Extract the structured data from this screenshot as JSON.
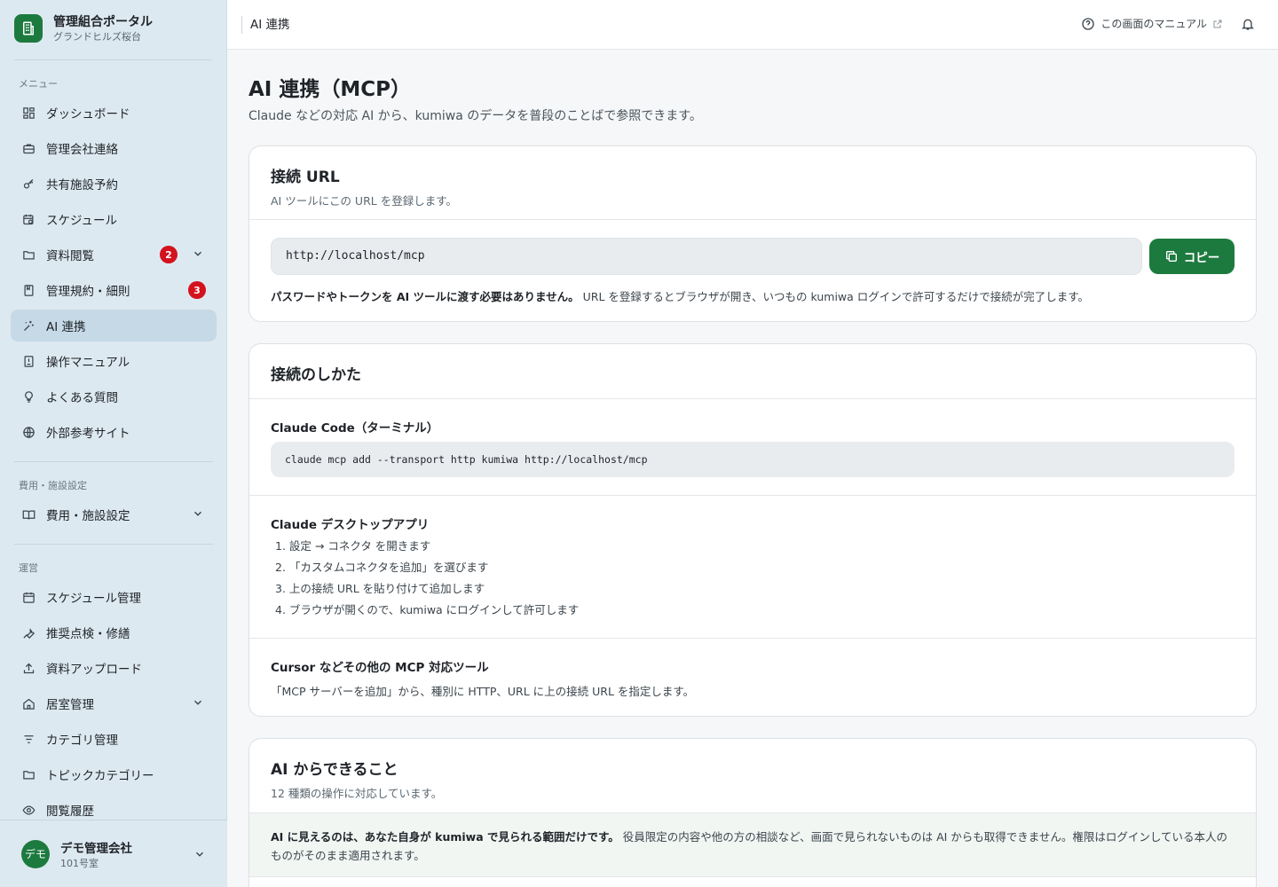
{
  "brand": {
    "title": "管理組合ポータル",
    "subtitle": "グランドヒルズ桜台"
  },
  "sidebar": {
    "menu_label": "メニュー",
    "items": [
      {
        "label": "ダッシュボード",
        "icon": "dashboard-icon"
      },
      {
        "label": "管理会社連絡",
        "icon": "briefcase-icon"
      },
      {
        "label": "共有施設予約",
        "icon": "key-icon"
      },
      {
        "label": "スケジュール",
        "icon": "calendar-clock-icon"
      },
      {
        "label": "資料閲覧",
        "icon": "folder-icon",
        "badge": "2"
      },
      {
        "label": "管理規約・細則",
        "icon": "book-icon",
        "badge": "3"
      },
      {
        "label": "AI 連携",
        "icon": "sparkle-icon",
        "active": true
      },
      {
        "label": "操作マニュアル",
        "icon": "manual-icon"
      },
      {
        "label": "よくある質問",
        "icon": "lightbulb-icon"
      },
      {
        "label": "外部参考サイト",
        "icon": "globe-icon"
      }
    ],
    "fees_label": "費用・施設設定",
    "fees_item": "費用・施設設定",
    "ops_label": "運営",
    "ops_items": [
      {
        "label": "スケジュール管理",
        "icon": "calendar-icon"
      },
      {
        "label": "推奨点検・修繕",
        "icon": "wrench-icon"
      },
      {
        "label": "資料アップロード",
        "icon": "upload-icon"
      },
      {
        "label": "居室管理",
        "icon": "home-icon"
      },
      {
        "label": "カテゴリ管理",
        "icon": "filter-icon"
      },
      {
        "label": "トピックカテゴリー",
        "icon": "folder-icon"
      },
      {
        "label": "閲覧履歴",
        "icon": "eye-icon"
      }
    ]
  },
  "user": {
    "avatar": "デモ",
    "name": "デモ管理会社",
    "room": "101号室"
  },
  "header": {
    "breadcrumb": "AI 連携",
    "manual_link": "この画面のマニュアル"
  },
  "page": {
    "title": "AI 連携（MCP）",
    "subtitle": "Claude などの対応 AI から、kumiwa のデータを普段のことばで参照できます。"
  },
  "url_card": {
    "title": "接続 URL",
    "desc": "AI ツールにこの URL を登録します。",
    "url": "http://localhost/mcp",
    "copy_label": "コピー",
    "note_bold": "パスワードやトークンを AI ツールに渡す必要はありません。",
    "note_rest": " URL を登録するとブラウザが開き、いつもの kumiwa ログインで許可するだけで接続が完了します。"
  },
  "howto_card": {
    "title": "接続のしかた",
    "claude_code_title": "Claude Code（ターミナル）",
    "claude_code_cmd": "claude mcp add --transport http kumiwa http://localhost/mcp",
    "desktop_title": "Claude デスクトップアプリ",
    "desktop_steps": [
      "1. 設定 → コネクタ を開きます",
      "2. 「カスタムコネクタを追加」を選びます",
      "3. 上の接続 URL を貼り付けて追加します",
      "4. ブラウザが開くので、kumiwa にログインして許可します"
    ],
    "other_title": "Cursor などその他の MCP 対応ツール",
    "other_desc": "「MCP サーバーを追加」から、種別に HTTP、URL に上の接続 URL を指定します。"
  },
  "ai_card": {
    "title": "AI からできること",
    "desc": "12 種類の操作に対応しています。",
    "info_bold": "AI に見えるのは、あなた自身が kumiwa で見られる範囲だけです。",
    "info_rest": " 役員限定の内容や他の方の相談など、画面で見られないものは AI からも取得できません。権限はログインしている本人のものがそのまま適用されます。"
  },
  "colors": {
    "accent": "#1d7a3f",
    "sidebar_bg": "#dde9f1",
    "badge": "#d3121d"
  }
}
